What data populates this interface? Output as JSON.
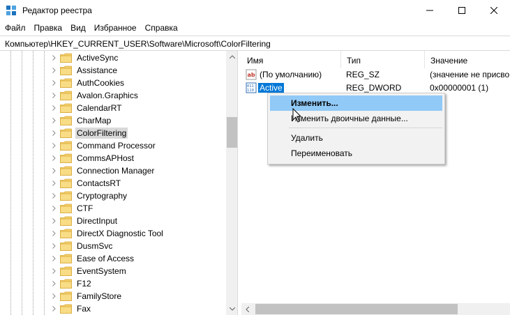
{
  "window": {
    "title": "Редактор реестра",
    "icon": "registry-editor-icon"
  },
  "menu": [
    "Файл",
    "Правка",
    "Вид",
    "Избранное",
    "Справка"
  ],
  "address": "Компьютер\\HKEY_CURRENT_USER\\Software\\Microsoft\\ColorFiltering",
  "tree": {
    "items": [
      "ActiveSync",
      "Assistance",
      "AuthCookies",
      "Avalon.Graphics",
      "CalendarRT",
      "CharMap",
      "ColorFiltering",
      "Command Processor",
      "CommsAPHost",
      "Connection Manager",
      "ContactsRT",
      "Cryptography",
      "CTF",
      "DirectInput",
      "DirectX Diagnostic Tool",
      "DusmSvc",
      "Ease of Access",
      "EventSystem",
      "F12",
      "FamilyStore",
      "Fax"
    ],
    "selected": "ColorFiltering"
  },
  "list": {
    "columns": [
      "Имя",
      "Тип",
      "Значение"
    ],
    "rows": [
      {
        "name": "(По умолчанию)",
        "type": "REG_SZ",
        "data": "(значение не присво",
        "icon": "string-value-icon"
      },
      {
        "name": "Active",
        "type": "REG_DWORD",
        "data": "0x00000001 (1)",
        "icon": "binary-value-icon"
      }
    ]
  },
  "context_menu": {
    "items": [
      "Изменить...",
      "Изменить двоичные данные...",
      "Удалить",
      "Переименовать"
    ]
  },
  "colors": {
    "selection": "#0078d7",
    "menu_hover": "#91c9f7",
    "folder": "#f3d06b"
  }
}
